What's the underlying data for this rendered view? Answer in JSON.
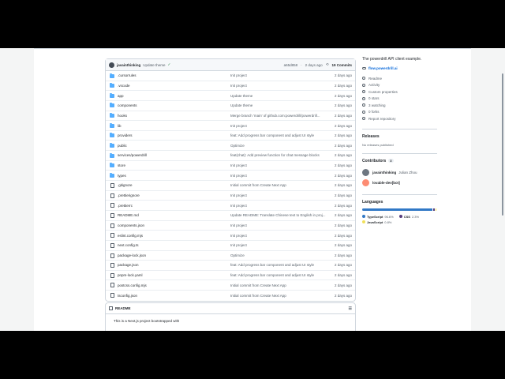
{
  "latest_commit": {
    "author": "javainthinking",
    "message": "Update theme",
    "hash": "a65d858",
    "time": "2 days ago",
    "commits": "19 Commits"
  },
  "files": [
    {
      "name": ".cursorrules",
      "type": "folder",
      "message": "Init project",
      "date": "2 days ago"
    },
    {
      "name": ".vscode",
      "type": "folder",
      "message": "Init project",
      "date": "2 days ago"
    },
    {
      "name": "app",
      "type": "folder",
      "message": "Update theme",
      "date": "2 days ago"
    },
    {
      "name": "components",
      "type": "folder",
      "message": "Update theme",
      "date": "2 days ago"
    },
    {
      "name": "hooks",
      "type": "folder",
      "message": "Merge branch 'main' of github.com:powerdrill/powerdrill...",
      "date": "2 days ago"
    },
    {
      "name": "lib",
      "type": "folder",
      "message": "Init project",
      "date": "2 days ago"
    },
    {
      "name": "providers",
      "type": "folder",
      "message": "feat: Add progress bar component and adjust UI style",
      "date": "2 days ago"
    },
    {
      "name": "public",
      "type": "folder",
      "message": "Optimize",
      "date": "2 days ago"
    },
    {
      "name": "services/powerdrill",
      "type": "folder",
      "message": "feat(chat): Add preview function for chat message blocks",
      "date": "2 days ago"
    },
    {
      "name": "store",
      "type": "folder",
      "message": "Init project",
      "date": "2 days ago"
    },
    {
      "name": "types",
      "type": "folder",
      "message": "Init project",
      "date": "2 days ago"
    },
    {
      "name": ".gitignore",
      "type": "file",
      "message": "Initial commit from Create Next App",
      "date": "2 days ago"
    },
    {
      "name": ".prettierignore",
      "type": "file",
      "message": "Init project",
      "date": "2 days ago"
    },
    {
      "name": ".prettierrc",
      "type": "file",
      "message": "Init project",
      "date": "2 days ago"
    },
    {
      "name": "README.md",
      "type": "file",
      "message": "Update README: Translate Chinese text to English in proj...",
      "date": "2 days ago"
    },
    {
      "name": "components.json",
      "type": "file",
      "message": "Init project",
      "date": "2 days ago"
    },
    {
      "name": "eslint.config.mjs",
      "type": "file",
      "message": "Init project",
      "date": "2 days ago"
    },
    {
      "name": "next.config.ts",
      "type": "file",
      "message": "Init project",
      "date": "2 days ago"
    },
    {
      "name": "package-lock.json",
      "type": "file",
      "message": "Optimize",
      "date": "2 days ago"
    },
    {
      "name": "package.json",
      "type": "file",
      "message": "feat: Add progress bar component and adjust UI style",
      "date": "2 days ago"
    },
    {
      "name": "pnpm-lock.yaml",
      "type": "file",
      "message": "feat: Add progress bar component and adjust UI style",
      "date": "2 days ago"
    },
    {
      "name": "postcss.config.mjs",
      "type": "file",
      "message": "Initial commit from Create Next App",
      "date": "2 days ago"
    },
    {
      "name": "tsconfig.json",
      "type": "file",
      "message": "Initial commit from Create Next App",
      "date": "2 days ago"
    }
  ],
  "readme": {
    "title": "README",
    "body": "This is a Next.js project bootstrapped with"
  },
  "sidebar": {
    "description": "The powerdrill API client example.",
    "website": "flow.powerdrill.ai",
    "meta": [
      "Readme",
      "Activity",
      "Custom properties",
      "0 stars",
      "3 watching",
      "0 forks",
      "Report repository"
    ],
    "releases_title": "Releases",
    "releases_empty": "No releases published",
    "contributors_title": "Contributors",
    "contributors_count": "3",
    "contributors": [
      {
        "login": "javainthinking",
        "name": "Julian Zhou",
        "color": "#6e7781"
      },
      {
        "login": "lovable-dev[bot]",
        "name": "",
        "color": "#fd8c73"
      }
    ],
    "languages_title": "Languages",
    "languages": [
      {
        "name": "TypeScript",
        "pct": "96.6%",
        "value": 96.6,
        "color": "#3178c6"
      },
      {
        "name": "CSS",
        "pct": "2.3%",
        "value": 2.3,
        "color": "#563d7c"
      },
      {
        "name": "JavaScript",
        "pct": "0.8%",
        "value": 0.8,
        "color": "#f1e05a"
      }
    ]
  }
}
